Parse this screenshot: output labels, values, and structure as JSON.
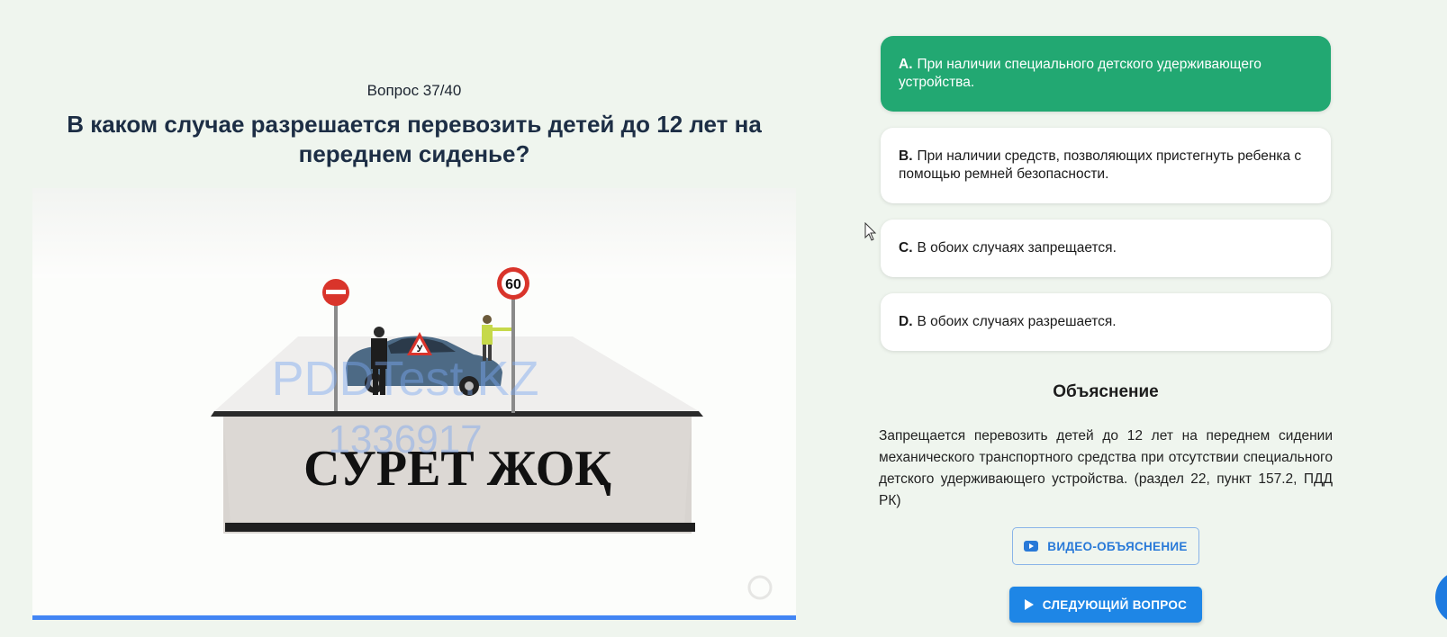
{
  "question": {
    "counter": "Вопрос 37/40",
    "title": "В каком случае разрешается перевозить детей до 12 лет на переднем сиденье?"
  },
  "image": {
    "caption": "СУРЕТ ЖОҚ",
    "watermark_line1": "PDDTest.KZ",
    "watermark_line2": "1336917",
    "speed_sign": "60",
    "triangle_sign": "У"
  },
  "answers": [
    {
      "letter": "A.",
      "text": "При наличии специального детского удерживающего устройства.",
      "state": "correct"
    },
    {
      "letter": "B.",
      "text": "При наличии средств, позволяющих пристегнуть ребенка с помощью ремней безопасности.",
      "state": "default"
    },
    {
      "letter": "C.",
      "text": "В обоих случаях запрещается.",
      "state": "default"
    },
    {
      "letter": "D.",
      "text": "В обоих случаях разрешается.",
      "state": "default"
    }
  ],
  "explanation": {
    "title": "Объяснение",
    "text": "Запрещается перевозить детей до 12 лет на переднем сидении механического транспортного средства при отсутствии специального детского удерживающего устройства. (раздел 22, пункт 157.2, ПДД РК)"
  },
  "buttons": {
    "video": "ВИДЕО-ОБЪЯСНЕНИЕ",
    "next": "СЛЕДУЮЩИЙ ВОПРОС"
  },
  "colors": {
    "correct": "#22a872",
    "primary": "#1e86e6",
    "background": "#eff5ee"
  }
}
